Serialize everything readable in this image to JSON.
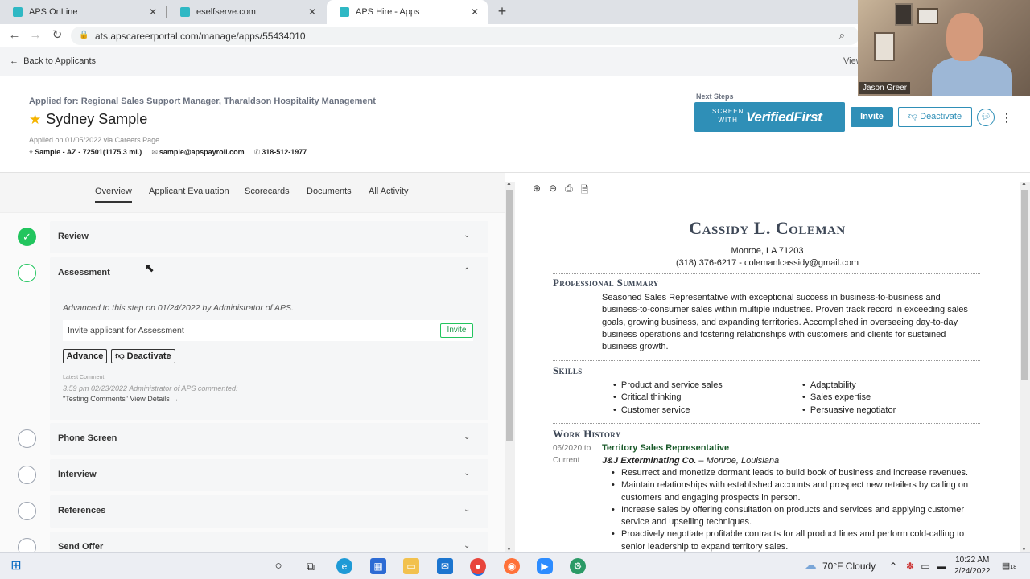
{
  "browser": {
    "tabs": [
      {
        "title": "APS OnLine",
        "color": "#2fb8c4"
      },
      {
        "title": "eselfserve.com",
        "color": "#2fb8c4"
      },
      {
        "title": "APS Hire - Apps",
        "color": "#2fb8c4"
      }
    ],
    "url": "ats.apscareerportal.com/manage/apps/55434010",
    "view_label": "View"
  },
  "topbar": {
    "back_label": "Back to Applicants"
  },
  "header": {
    "applied_for": "Applied for: Regional Sales Support Manager, Tharaldson Hospitality Management",
    "candidate_name": "Sydney Sample",
    "applied_on": "Applied on 01/05/2022 via Careers Page",
    "location": "Sample - AZ - 72501(1175.3 mi.)",
    "email": "sample@apspayroll.com",
    "phone": "318-512-1977",
    "next_steps_label": "Next Steps",
    "screen_with_line1": "SCREEN",
    "screen_with_line2": "WITH",
    "verified_first": "VerifiedFirst",
    "invite_label": "Invite",
    "deactivate_label": "Deactivate"
  },
  "webcam": {
    "participant": "Jason Greer"
  },
  "subtabs": [
    "Overview",
    "Applicant Evaluation",
    "Scorecards",
    "Documents",
    "All Activity"
  ],
  "steps": {
    "review": "Review",
    "assessment": "Assessment",
    "phone_screen": "Phone Screen",
    "interview": "Interview",
    "references": "References",
    "send_offer": "Send Offer"
  },
  "assessment": {
    "advanced_note": "Advanced to this step on 01/24/2022 by Administrator of APS.",
    "invite_text": "Invite applicant for Assessment",
    "invite_btn": "Invite",
    "advance_btn": "Advance",
    "deactivate_btn": "Deactivate",
    "latest_comment_label": "Latest Comment",
    "comment_meta": "3:59 pm 02/23/2022 Administrator of APS commented:",
    "comment_text": "\"Testing Comments\"",
    "view_details": "View Details →"
  },
  "resume": {
    "name": "Cassidy L. Coleman",
    "city": "Monroe, LA 71203",
    "contact": "(318) 376-6217 - colemanlcassidy@gmail.com",
    "sections": {
      "summary": "Professional Summary",
      "skills": "Skills",
      "work": "Work History"
    },
    "summary_text": "Seasoned Sales Representative with exceptional success in business-to-business and business-to-consumer sales within multiple industries. Proven track record in exceeding sales goals, growing business, and expanding territories. Accomplished in overseeing day-to-day business operations and fostering relationships with customers and clients for sustained business growth.",
    "skills_left": [
      "Product and service sales",
      "Critical thinking",
      "Customer service"
    ],
    "skills_right": [
      "Adaptability",
      "Sales expertise",
      "Persuasive negotiator"
    ],
    "job": {
      "dates_from": "06/2020 to",
      "dates_to": "Current",
      "title": "Territory Sales Representative",
      "company": "J&J Exterminating Co.",
      "location": " – Monroe, Louisiana",
      "bullets": [
        "Resurrect and monetize dormant leads to build book of business and increase revenues.",
        "Maintain relationships with established accounts and prospect new retailers by calling on customers and engaging prospects in person.",
        "Increase sales by offering consultation on products and services and applying customer service and upselling techniques.",
        "Proactively negotiate profitable contracts for all product lines and perform cold-calling to senior leadership to expand territory sales."
      ]
    }
  },
  "taskbar": {
    "weather": "70°F  Cloudy",
    "time": "10:22 AM",
    "date": "2/24/2022",
    "notification_count": "18"
  }
}
